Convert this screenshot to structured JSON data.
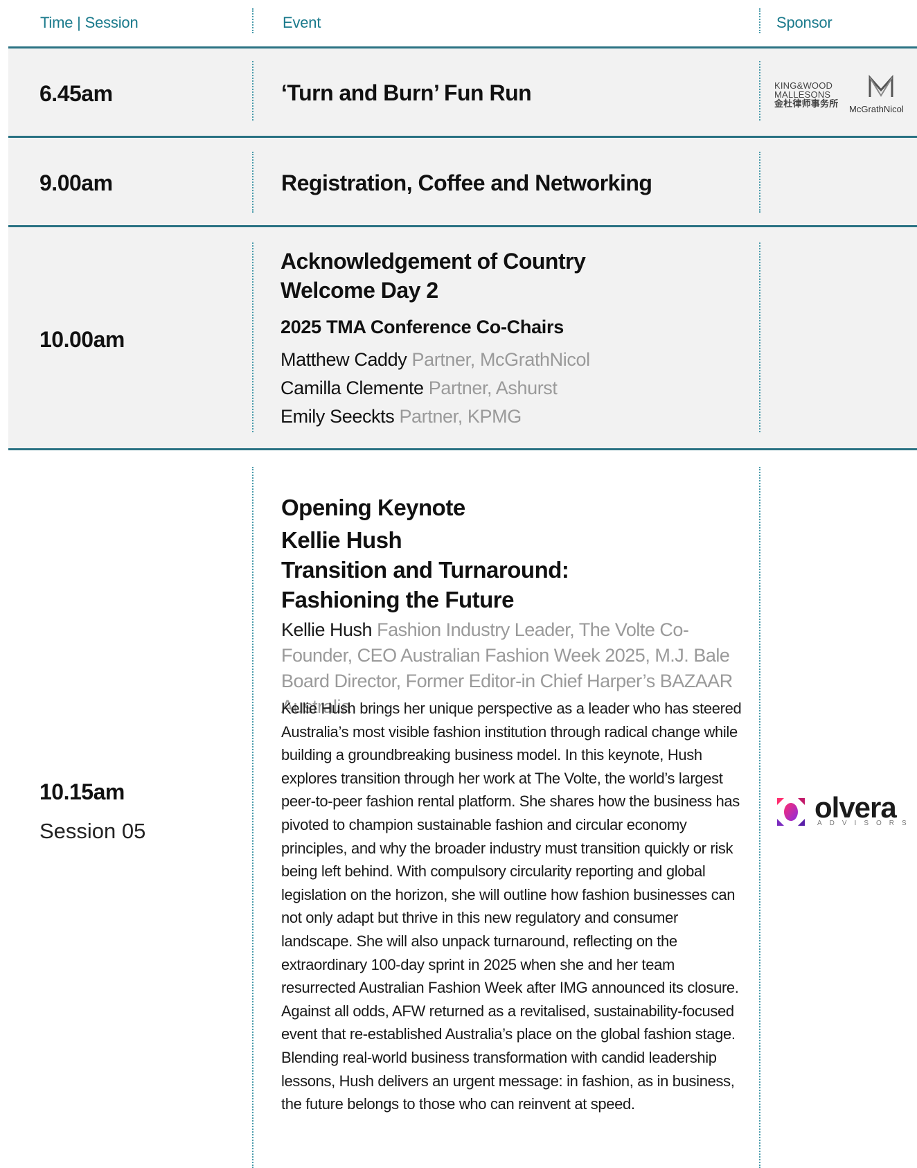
{
  "header": {
    "time_label": "Time | Session",
    "event_label": "Event",
    "sponsor_label": "Sponsor"
  },
  "rows": [
    {
      "time": "6.45am",
      "event": "‘Turn and Burn’ Fun Run",
      "sponsor_logos": [
        {
          "name": "King & Wood Mallesons",
          "lines": [
            "KING&WOOD",
            "MALLESONS",
            "金杜律师事务所"
          ]
        },
        {
          "name": "McGrathNicol",
          "text": "McGrathNicol"
        }
      ]
    },
    {
      "time": "9.00am",
      "event": "Registration, Coffee and Networking"
    },
    {
      "time": "10.00am",
      "event_lines": [
        "Acknowledgement of Country",
        "Welcome Day 2"
      ],
      "subtitle": "2025 TMA Conference Co-Chairs",
      "speakers": [
        {
          "name": "Matthew Caddy",
          "role": "Partner, McGrathNicol"
        },
        {
          "name": "Camilla Clemente",
          "role": "Partner, Ashurst"
        },
        {
          "name": "Emily Seeckts",
          "role": "Partner, KPMG"
        }
      ]
    },
    {
      "time": "10.15am",
      "session": "Session 05",
      "title_lines": [
        "Opening Keynote",
        "Kellie Hush",
        "Transition and Turnaround:",
        "Fashioning the Future"
      ],
      "speaker": {
        "name": "Kellie Hush",
        "role": "Fashion Industry Leader, The Volte Co-Founder, CEO Australian Fashion Week 2025, M.J. Bale Board Director, Former Editor-in Chief Harper’s BAZAAR Australia"
      },
      "description": "Kellie Hush brings her unique perspective as a leader who has steered Australia’s most visible fashion institution through radical change while building a groundbreaking business model. In this keynote, Hush explores transition through her work at The Volte, the world’s largest peer-to-peer fashion rental platform. She shares how the business has pivoted to champion sustainable fashion and circular economy principles, and why the broader industry must transition quickly or risk being left behind. With compulsory circularity reporting and global legislation on the horizon, she will outline how fashion businesses can not only adapt but thrive in this new regulatory and consumer landscape. She will also unpack turnaround, reflecting on the extraordinary 100-day sprint in 2025 when she and her team resurrected Australian Fashion Week after IMG announced its closure. Against all odds, AFW returned as a revitalised, sustainability-focused event that re-established Australia’s place on the global fashion stage. Blending real-world business transformation with candid leadership lessons, Hush delivers an urgent message: in fashion, as in business, the future belongs to those who can reinvent at speed.",
      "sponsor_logo": {
        "name": "Olvera Advisors",
        "word": "olvera",
        "sub": "ADVISORS"
      }
    }
  ],
  "colors": {
    "accent": "#1a7a8c",
    "rule": "#2a7283",
    "row_bg": "#f2f2f2",
    "muted": "#9a9a9a"
  }
}
